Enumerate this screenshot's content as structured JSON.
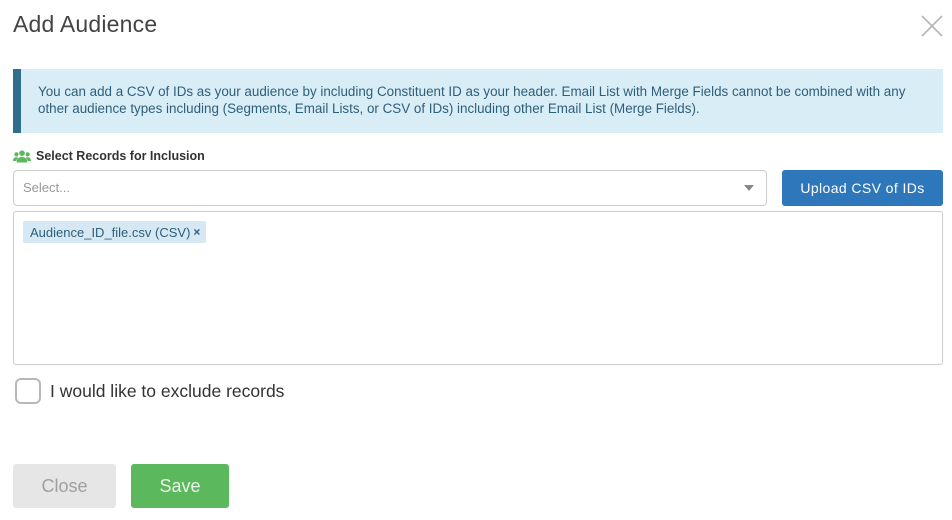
{
  "modal": {
    "title": "Add Audience",
    "close_icon": "close-icon"
  },
  "info": {
    "text": "You can add a CSV of IDs as your audience by including Constituent ID as your header. Email List with Merge Fields cannot be combined with any other audience types including (Segments, Email Lists, or CSV of IDs) including other Email List (Merge Fields)."
  },
  "inclusion": {
    "icon": "users-icon",
    "label": "Select Records for Inclusion",
    "select_placeholder": "Select...",
    "upload_button": "Upload CSV of IDs",
    "chips": [
      {
        "label": "Audience_ID_file.csv (CSV)",
        "remove": "×"
      }
    ]
  },
  "exclude": {
    "checked": false,
    "label": "I would like to exclude records"
  },
  "footer": {
    "close_label": "Close",
    "save_label": "Save"
  },
  "colors": {
    "info_bg": "#d9edf7",
    "info_border": "#2f6e8c",
    "primary": "#2e77bb",
    "save": "#5cb85c",
    "close_bg": "#e6e6e6",
    "users_icon": "#5cb85c"
  }
}
